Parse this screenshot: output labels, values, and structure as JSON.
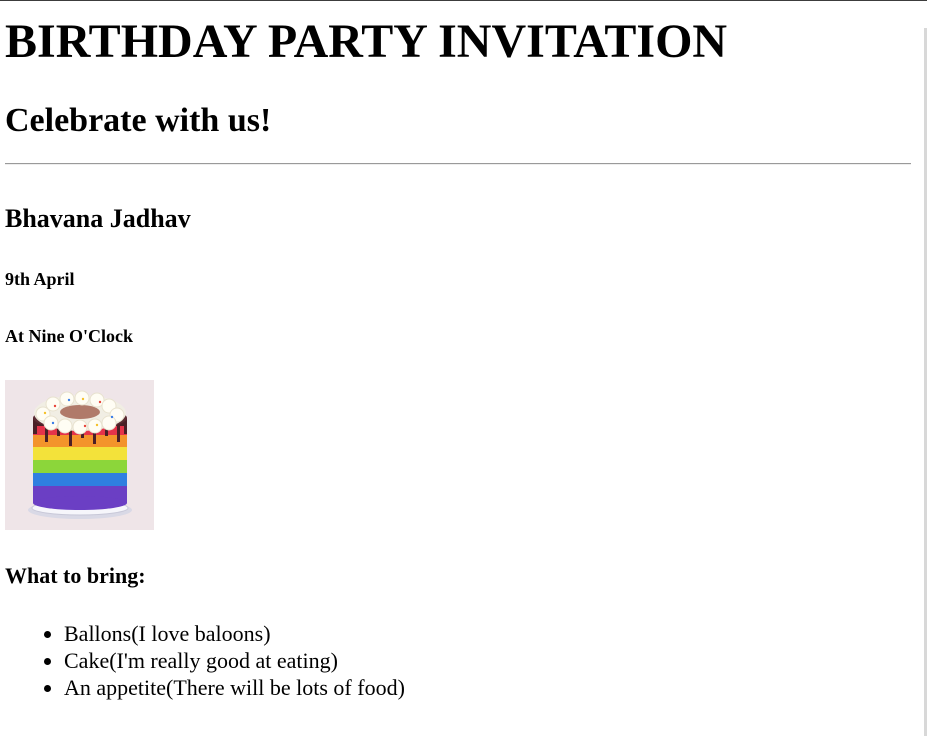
{
  "invitation": {
    "title": "BIRTHDAY PARTY INVITATION",
    "subtitle": "Celebrate with us!",
    "host_name": "Bhavana Jadhav",
    "date": "9th April",
    "time": "At Nine O'Clock",
    "cake_image_icon": "rainbow-cake-icon",
    "bring_heading": "What to bring:",
    "bring_items": [
      "Ballons(I love baloons)",
      "Cake(I'm really good at eating)",
      "An appetite(There will be lots of food)"
    ]
  },
  "colors": {
    "rule": "#9a9a9a",
    "image_background": "#efe5e8"
  }
}
